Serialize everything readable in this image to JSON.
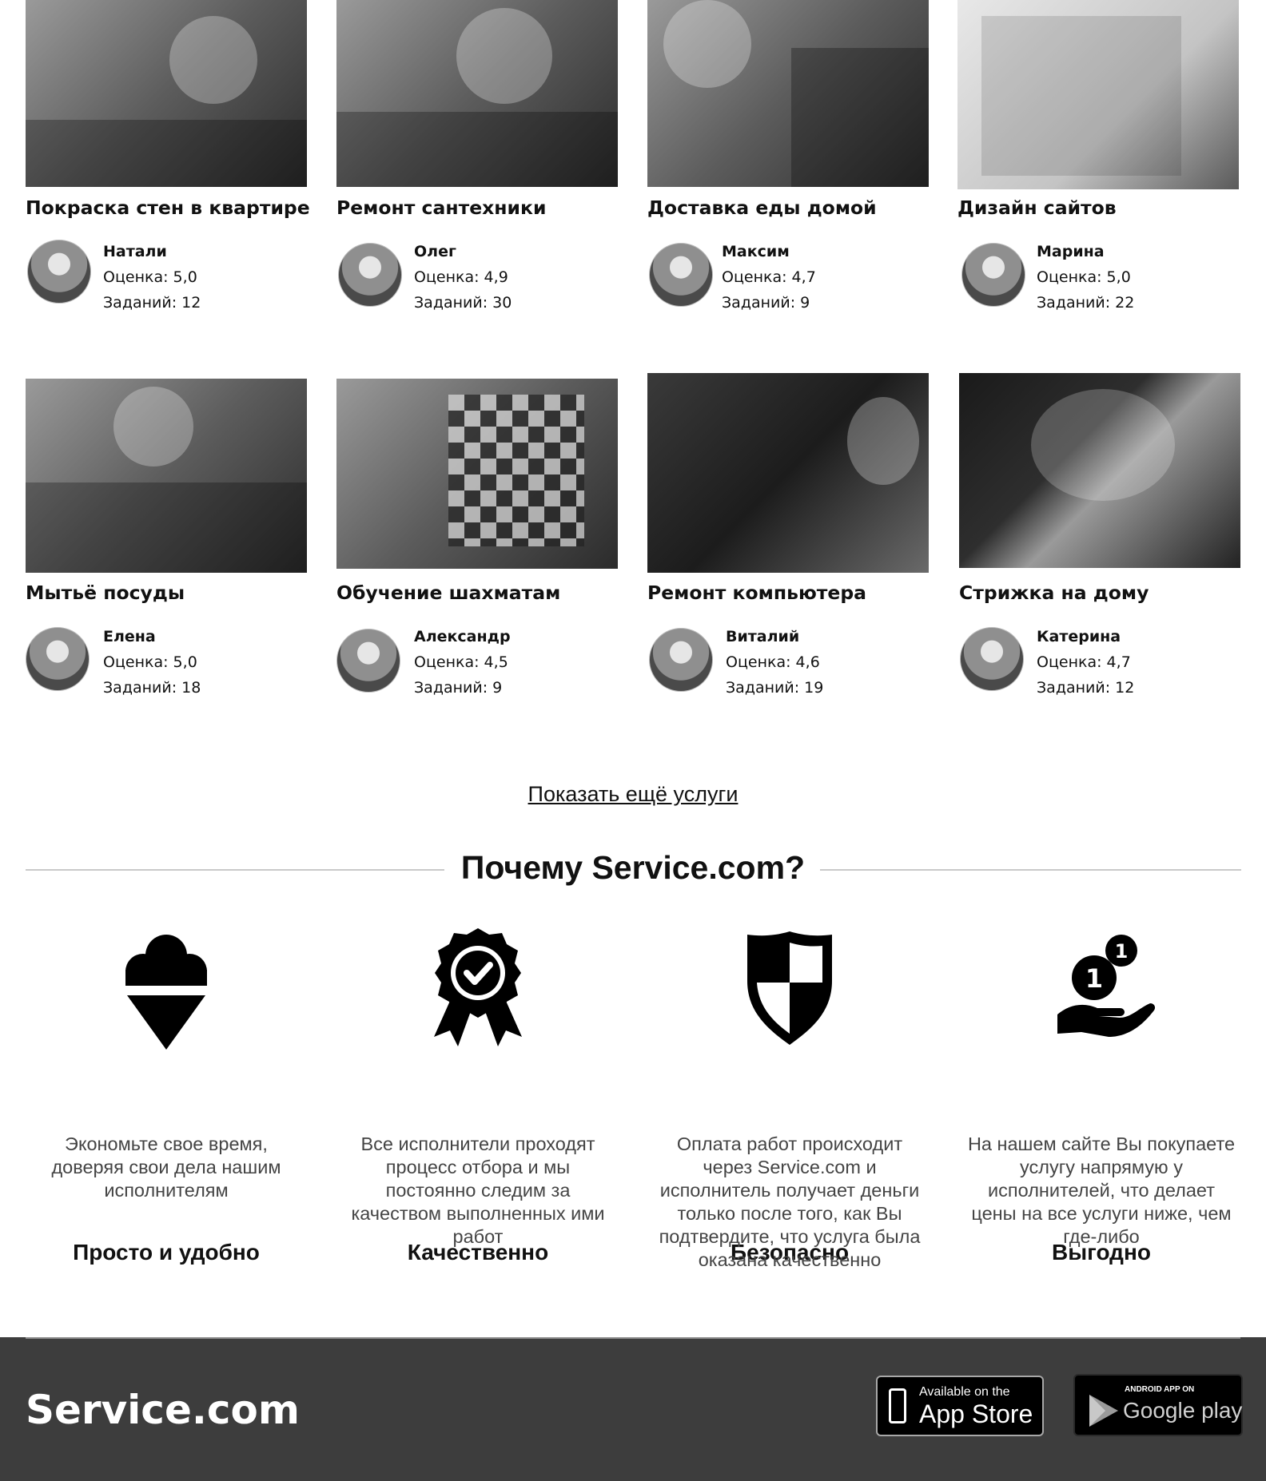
{
  "services": [
    {
      "title": "Покраска стен в квартире",
      "performer": "Натали",
      "rating": "Оценка: 5,0",
      "tasks": "Заданий: 12"
    },
    {
      "title": "Ремонт сантехники",
      "performer": "Олег",
      "rating": "Оценка: 4,9",
      "tasks": "Заданий: 30"
    },
    {
      "title": "Доставка еды домой",
      "performer": "Максим",
      "rating": "Оценка: 4,7",
      "tasks": "Заданий: 9"
    },
    {
      "title": "Дизайн сайтов",
      "performer": "Марина",
      "rating": "Оценка: 5,0",
      "tasks": "Заданий: 22"
    },
    {
      "title": "Мытьё посуды",
      "performer": "Елена",
      "rating": "Оценка: 5,0",
      "tasks": "Заданий: 18"
    },
    {
      "title": "Обучение шахматам",
      "performer": "Александр",
      "rating": "Оценка: 4,5",
      "tasks": "Заданий: 9"
    },
    {
      "title": "Ремонт компьютера",
      "performer": "Виталий",
      "rating": "Оценка: 4,6",
      "tasks": "Заданий: 19"
    },
    {
      "title": "Стрижка на дому",
      "performer": "Катерина",
      "rating": "Оценка: 4,7",
      "tasks": "Заданий: 12"
    }
  ],
  "show_more_label": "Показать ещё услуги",
  "why": {
    "title": "Почему Service.com?",
    "features": [
      {
        "icon": "ice-cream-icon",
        "title": "Просто и удобно",
        "text": "Экономьте свое время, доверяя свои дела нашим исполнителям"
      },
      {
        "icon": "award-badge-icon",
        "title": "Качественно",
        "text": "Все исполнители проходят процесс отбора и мы постоянно следим за качеством выполненных ими работ"
      },
      {
        "icon": "shield-icon",
        "title": "Безопасно",
        "text": "Оплата работ происходит через Service.com и исполнитель получает деньги только после того, как Вы подтвердите, что услуга была оказана качественно"
      },
      {
        "icon": "coin-hand-icon",
        "title": "Выгодно",
        "text": "На нашем сайте Вы покупаете услугу напрямую у исполнителей, что делает цены на все услуги ниже, чем где-либо"
      }
    ]
  },
  "footer": {
    "logo": "Service.com",
    "app_store": {
      "small": "Available on the",
      "big": "App Store"
    },
    "google_play": {
      "small": "ANDROID APP ON",
      "big": "Google play"
    }
  },
  "colors": {
    "footer_bg": "#3d3d3d",
    "text": "#111111",
    "muted": "#444444",
    "divider": "#c9c9c9"
  }
}
